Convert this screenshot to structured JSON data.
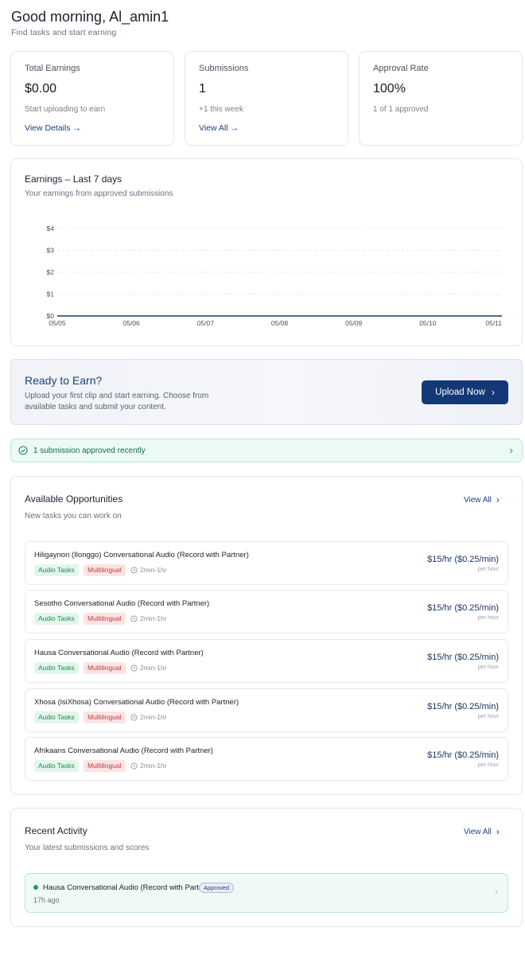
{
  "header": {
    "greeting": "Good morning, Al_amin1",
    "subtitle": "Find tasks and start earning"
  },
  "stats": [
    {
      "label": "Total Earnings",
      "value": "$0.00",
      "sub": "Start uploading to earn",
      "link": "View Details"
    },
    {
      "label": "Submissions",
      "value": "1",
      "sub": "+1 this week",
      "link": "View All"
    },
    {
      "label": "Approval Rate",
      "value": "100%",
      "sub": "1 of 1 approved",
      "link": ""
    }
  ],
  "earnings_chart": {
    "title": "Earnings – Last 7 days",
    "subtitle": "Your earnings from approved submissions"
  },
  "chart_data": {
    "type": "line",
    "x": [
      "05/05",
      "05/06",
      "05/07",
      "05/08",
      "05/09",
      "05/10",
      "05/11"
    ],
    "y_ticks": [
      "$4",
      "$3",
      "$2",
      "$1",
      "$0"
    ],
    "series": [
      {
        "values": [
          0,
          0,
          0,
          0,
          0,
          0,
          0
        ]
      }
    ],
    "ylim": [
      0,
      4
    ],
    "grid": true
  },
  "banner": {
    "title": "Ready to Earn?",
    "text": "Upload your first clip and start earning. Choose from available tasks and submit your content.",
    "button": "Upload Now"
  },
  "alert": {
    "text": "1 submission approved recently"
  },
  "opportunities": {
    "title": "Available Opportunities",
    "subtitle": "New tasks you can work on",
    "view_all": "View All",
    "tasks": [
      {
        "title": "Hiligaynon (Ilonggo) Conversational Audio (Record with Partner)",
        "tag1": "Audio Tasks",
        "tag2": "Multilingual",
        "duration": "2min-1hr",
        "rate": "$15/hr ($0.25/min)",
        "per": "per hour"
      },
      {
        "title": "Sesotho Conversational Audio (Record with Partner)",
        "tag1": "Audio Tasks",
        "tag2": "Multilingual",
        "duration": "2min-1hr",
        "rate": "$15/hr ($0.25/min)",
        "per": "per hour"
      },
      {
        "title": "Hausa Conversational Audio (Record with Partner)",
        "tag1": "Audio Tasks",
        "tag2": "Multilingual",
        "duration": "2min-1hr",
        "rate": "$15/hr ($0.25/min)",
        "per": "per hour"
      },
      {
        "title": "Xhosa (isiXhosa) Conversational Audio (Record with Partner)",
        "tag1": "Audio Tasks",
        "tag2": "Multilingual",
        "duration": "2min-1hr",
        "rate": "$15/hr ($0.25/min)",
        "per": "per hour"
      },
      {
        "title": "Afrikaans Conversational Audio (Record with Partner)",
        "tag1": "Audio Tasks",
        "tag2": "Multilingual",
        "duration": "2min-1hr",
        "rate": "$15/hr ($0.25/min)",
        "per": "per hour"
      }
    ]
  },
  "recent_activity": {
    "title": "Recent Activity",
    "subtitle": "Your latest submissions and scores",
    "view_all": "View All",
    "items": [
      {
        "title": "Hausa Conversational Audio (Record with Partner)",
        "status": "Approved",
        "time": "17h ago"
      }
    ]
  },
  "colors": {
    "accent": "#143876",
    "success": "#1f8a52",
    "success_bg": "#ebfaf4",
    "danger": "#c23b3b"
  }
}
